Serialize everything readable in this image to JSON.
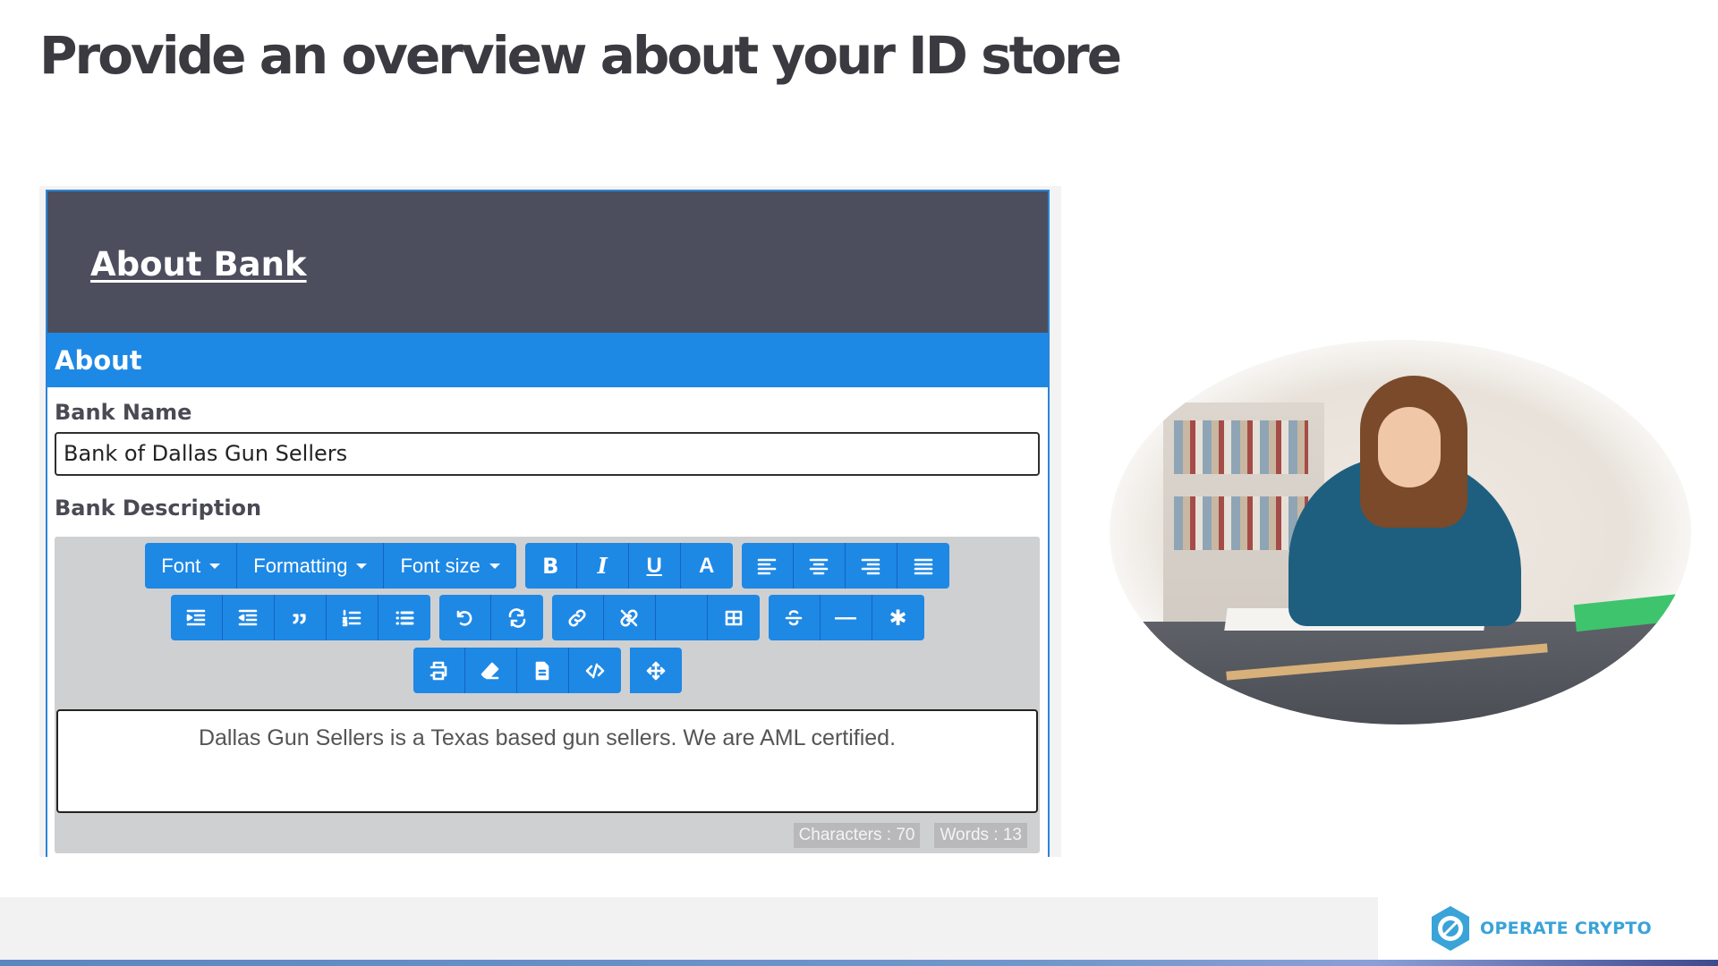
{
  "slide": {
    "title": "Provide an overview about your ID store"
  },
  "form": {
    "header_title": "About Bank",
    "section_title": "About",
    "bank_name_label": "Bank Name",
    "bank_name_value": "Bank of Dallas Gun Sellers",
    "bank_description_label": "Bank Description",
    "description_text": "Dallas Gun Sellers is a Texas based gun sellers. We are AML certified.",
    "characters_label": "Characters : 70",
    "words_label": "Words : 13"
  },
  "toolbar": {
    "font_label": "Font",
    "formatting_label": "Formatting",
    "font_size_label": "Font size",
    "bold_glyph": "B",
    "italic_glyph": "I",
    "underline_glyph": "U",
    "color_glyph": "A",
    "hr_glyph": "—",
    "special_char_glyph": "✱",
    "icons": [
      "bold-icon",
      "italic-icon",
      "underline-icon",
      "font-color-icon",
      "align-left-icon",
      "align-center-icon",
      "align-right-icon",
      "align-justify-icon",
      "indent-icon",
      "outdent-icon",
      "quote-icon",
      "ordered-list-icon",
      "unordered-list-icon",
      "undo-icon",
      "redo-icon",
      "link-icon",
      "unlink-icon",
      "table-icon",
      "strikethrough-icon",
      "horizontal-rule-icon",
      "special-char-icon",
      "print-icon",
      "eraser-icon",
      "document-icon",
      "code-icon",
      "fullscreen-icon"
    ],
    "accent_color": "#1e88e5"
  },
  "branding": {
    "logo_text": "OPERATE CRYPTO",
    "logo_color": "#3aa3d8"
  },
  "colors": {
    "header_bg": "#4c4e5e",
    "section_bg": "#1e88e5",
    "editor_bg": "#cfd0d2"
  }
}
